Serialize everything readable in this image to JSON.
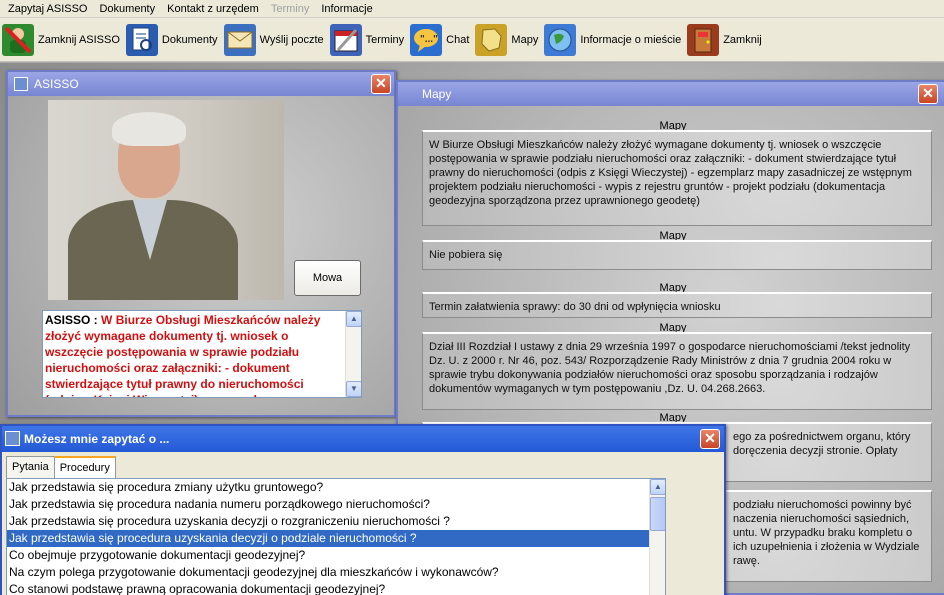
{
  "menubar": {
    "items": [
      {
        "label": "Zapytaj ASISSO",
        "disabled": false
      },
      {
        "label": "Dokumenty",
        "disabled": false
      },
      {
        "label": "Kontakt z urzędem",
        "disabled": false
      },
      {
        "label": "Terminy",
        "disabled": true
      },
      {
        "label": "Informacje",
        "disabled": false
      }
    ]
  },
  "toolbar": {
    "buttons": [
      {
        "label": "Zamknij ASISSO",
        "icon": "close-user-icon",
        "color": "#2f8a2f"
      },
      {
        "label": "Dokumenty",
        "icon": "documents-icon",
        "color": "#2a5db0"
      },
      {
        "label": "Wyślij poczte",
        "icon": "send-mail-icon",
        "color": "#3d6fc1"
      },
      {
        "label": "Terminy",
        "icon": "calendar-icon",
        "color": "#3f63b8"
      },
      {
        "label": "Chat",
        "icon": "chat-icon",
        "color": "#2a6ed0"
      },
      {
        "label": "Mapy",
        "icon": "map-icon",
        "color": "#c9a227"
      },
      {
        "label": "Informacje o mieście",
        "icon": "globe-icon",
        "color": "#3e7bd6"
      },
      {
        "label": "Zamknij",
        "icon": "exit-icon",
        "color": "#9b3b1e"
      }
    ]
  },
  "asisso": {
    "title": "ASISSO",
    "speak_button": "Mowa",
    "speaker": "ASISSO :",
    "message": "W Biurze Obsługi Mieszkańców należy złożyć wymagane dokumenty tj. wniosek o wszczęcie postępowania w sprawie podziału nieruchomości oraz załączniki: - dokument stwierdzające tytuł prawny do nieruchomości (odpis z Księgi Wieczystej) - egzemplarz mapy zasadniczej"
  },
  "mapy": {
    "title": "Mapy",
    "sections": [
      {
        "title": "Mapy",
        "text": "W Biurze Obsługi Mieszkańców należy złożyć wymagane dokumenty tj. wniosek o wszczęcie postępowania w sprawie podziału nieruchomości oraz załączniki: - dokument stwierdzające tytuł prawny do nieruchomości (odpis z Księgi Wieczystej) - egzemplarz mapy zasadniczej ze wstępnym projektem podziału nieruchomości - wypis z rejestru gruntów - projekt podziału (dokumentacja geodezyjna sporządzona przez uprawnionego geodetę)"
      },
      {
        "title": "Mapy",
        "text": "Nie pobiera się"
      },
      {
        "title": "Mapy",
        "text": "Termin załatwienia sprawy: do 30 dni od wpłynięcia wniosku"
      },
      {
        "title": "Mapy",
        "text": "Dział III Rozdział I ustawy z dnia 29 września 1997 o gospodarce nieruchomościami /tekst jednolity Dz. U. z 2000 r. Nr 46, poz. 543/ Rozporządzenie Rady Ministrów z dnia 7 grudnia 2004 roku w sprawie trybu dokonywania podziałów nieruchomości oraz sposobu sporządzania i rodzajów dokumentów wymaganych w tym postępowaniu ,Dz. U. 04.268.2663."
      },
      {
        "title": "Mapy",
        "text": "ego za pośrednictwem organu, który doręczenia decyzji stronie. Opłaty"
      },
      {
        "title": "",
        "text": "podziału nieruchomości powinny być naczenia nieruchomości sąsiednich, untu. W przypadku braku kompletu o ich uzupełnienia i złożenia w Wydziale rawę."
      }
    ]
  },
  "ask": {
    "title": "Możesz mnie zapytać o ...",
    "tabs": [
      {
        "label": "Pytania",
        "active": false
      },
      {
        "label": "Procedury",
        "active": true
      }
    ],
    "items": [
      {
        "label": "Jak przedstawia się  procedura zmiany użytku gruntowego?",
        "selected": false
      },
      {
        "label": "Jak przedstawia się procedura nadania numeru porządkowego nieruchomości?",
        "selected": false
      },
      {
        "label": "Jak przedstawia się procedura uzyskania decyzji o rozgraniczeniu nieruchomości ?",
        "selected": false
      },
      {
        "label": "Jak przedstawia się procedura uzyskania decyzji o podziale nieruchomości ?",
        "selected": true
      },
      {
        "label": "Co obejmuje przygotowanie dokumentacji geodezyjnej?",
        "selected": false
      },
      {
        "label": "Na czym polega przygotowanie dokumentacji geodezyjnej  dla mieszkańców i wykonawców?",
        "selected": false
      },
      {
        "label": "Co stanowi podstawę prawną opracowania dokumentacji geodezyjnej?",
        "selected": false
      }
    ]
  }
}
